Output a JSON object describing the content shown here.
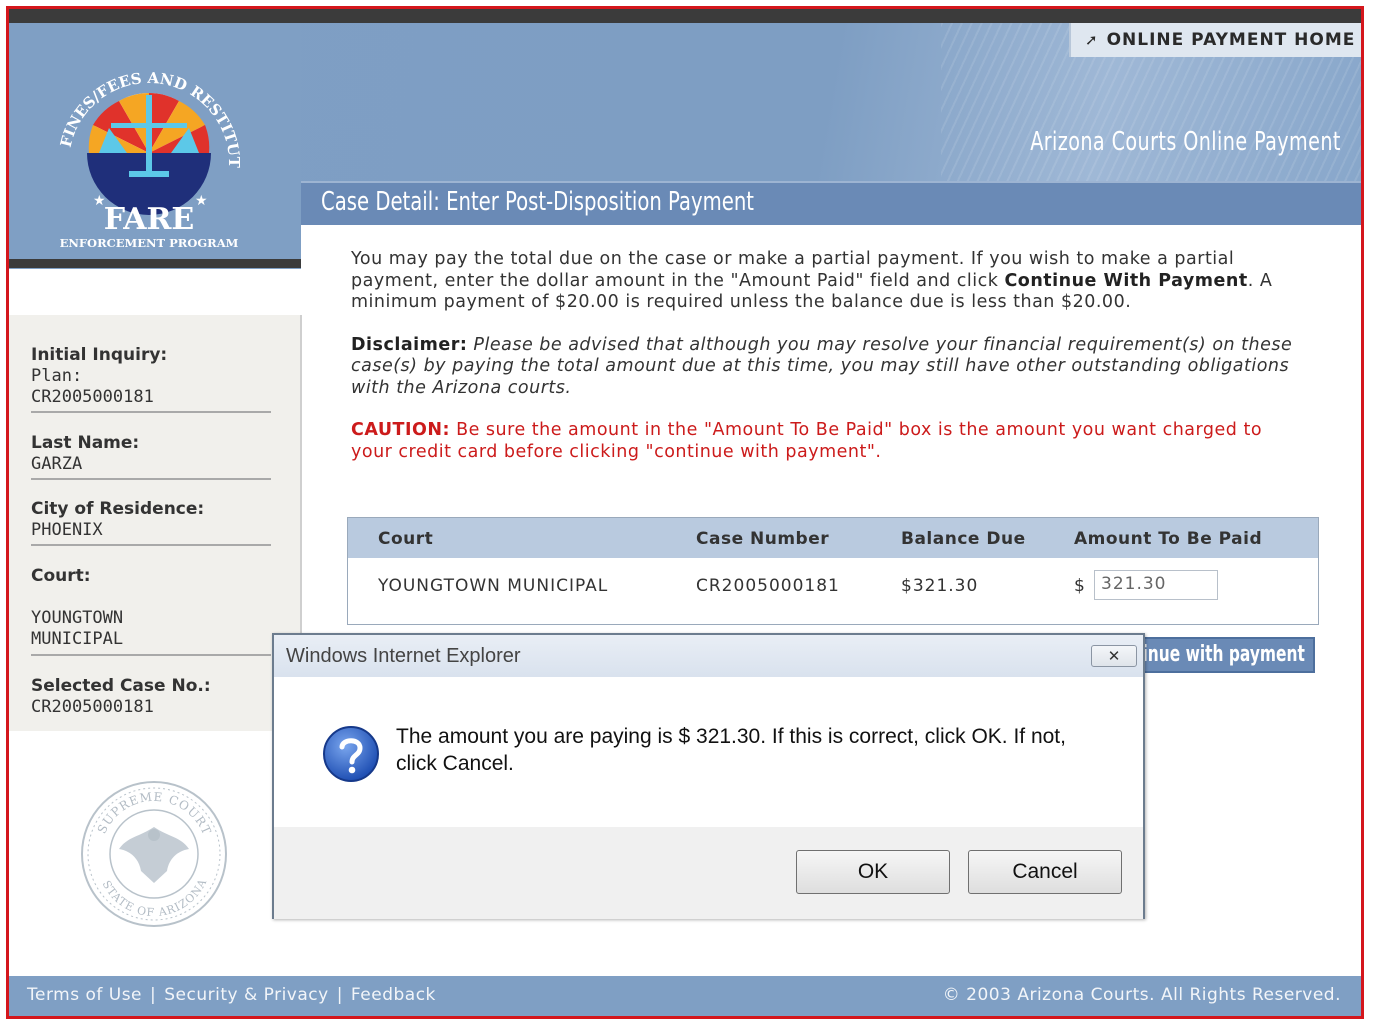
{
  "header": {
    "online_home": "ONLINE PAYMENT HOME",
    "site_title": "Arizona Courts Online Payment",
    "logo_text_arc": "FINES/FEES AND RESTITUTION",
    "logo_name": "FARE",
    "logo_sub": "ENFORCEMENT PROGRAM"
  },
  "section": {
    "title": "Case Detail: Enter Post-Disposition Payment"
  },
  "sidebar": {
    "initial_inquiry_label": "Initial Inquiry:",
    "plan_label": "Plan:",
    "plan_value": "CR2005000181",
    "last_name_label": "Last Name:",
    "last_name_value": "GARZA",
    "city_label": "City of Residence:",
    "city_value": "PHOENIX",
    "court_label": "Court:",
    "court_value_1": "YOUNGTOWN",
    "court_value_2": "MUNICIPAL",
    "case_label": "Selected Case No.:",
    "case_value": "CR2005000181",
    "seal_text_top": "SUPREME COURT",
    "seal_text_bottom": "STATE OF ARIZONA"
  },
  "content": {
    "intro_1": "You may pay the total due on the case or make a partial payment. If you wish to make a partial payment, enter the dollar amount in the \"Amount Paid\" field and click ",
    "intro_bold": "Continue With Payment",
    "intro_2": ". A minimum payment of $20.00 is required unless the balance due is less than $20.00.",
    "disclaimer_label": "Disclaimer:",
    "disclaimer_text": " Please be advised that although you may resolve your financial requirement(s) on these case(s) by paying the total amount due at this time, you may still have other outstanding obligations with the Arizona courts.",
    "caution_label": "CAUTION:",
    "caution_text": " Be sure the amount in the \"Amount To Be Paid\" box is the amount you want charged to your credit card before clicking \"continue with payment\"."
  },
  "table": {
    "headers": [
      "Court",
      "Case Number",
      "Balance Due",
      "Amount To Be Paid"
    ],
    "row": {
      "court": "YOUNGTOWN MUNICIPAL",
      "case_number": "CR2005000181",
      "balance_due": "$321.30",
      "currency": "$",
      "amount": "321.30"
    }
  },
  "continue_label": "Continue with payment",
  "footer": {
    "links": [
      "Terms of Use",
      "Security & Privacy",
      "Feedback"
    ],
    "separator": "|",
    "copyright": "© 2003 Arizona Courts. All Rights Reserved."
  },
  "dialog": {
    "title": "Windows Internet Explorer",
    "close_glyph": "✕",
    "message": "The amount you are paying is $ 321.30. If this is correct, click OK.  If not, click Cancel.",
    "ok_label": "OK",
    "cancel_label": "Cancel",
    "icon": "question-icon"
  },
  "colors": {
    "header_blue": "#7f9fc4",
    "section_blue": "#6a8ab6",
    "frame_red": "#d4161c",
    "caution_red": "#cc1b1b"
  }
}
